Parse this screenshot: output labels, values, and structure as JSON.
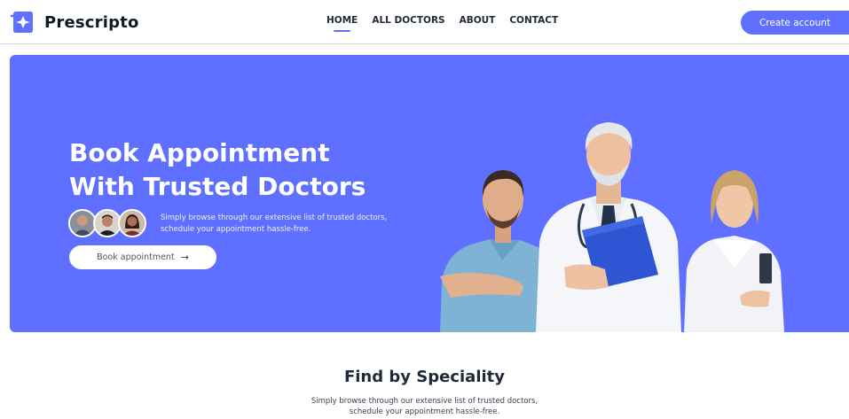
{
  "brand": {
    "name": "Prescripto",
    "accent": "#5f6fff"
  },
  "nav": {
    "links": [
      {
        "label": "HOME",
        "active": true
      },
      {
        "label": "ALL DOCTORS",
        "active": false
      },
      {
        "label": "ABOUT",
        "active": false
      },
      {
        "label": "CONTACT",
        "active": false
      }
    ],
    "cta": "Create account"
  },
  "hero": {
    "title_line1": "Book Appointment",
    "title_line2": "With Trusted Doctors",
    "desc_line1": "Simply browse through our extensive list of trusted doctors,",
    "desc_line2": "schedule your appointment hassle-free.",
    "button": "Book appointment",
    "button_icon": "arrow-right-icon",
    "background": "#5f6fff"
  },
  "speciality": {
    "title": "Find by Speciality",
    "desc_line1": "Simply browse through our extensive list of trusted doctors,",
    "desc_line2": "schedule your appointment hassle-free."
  }
}
